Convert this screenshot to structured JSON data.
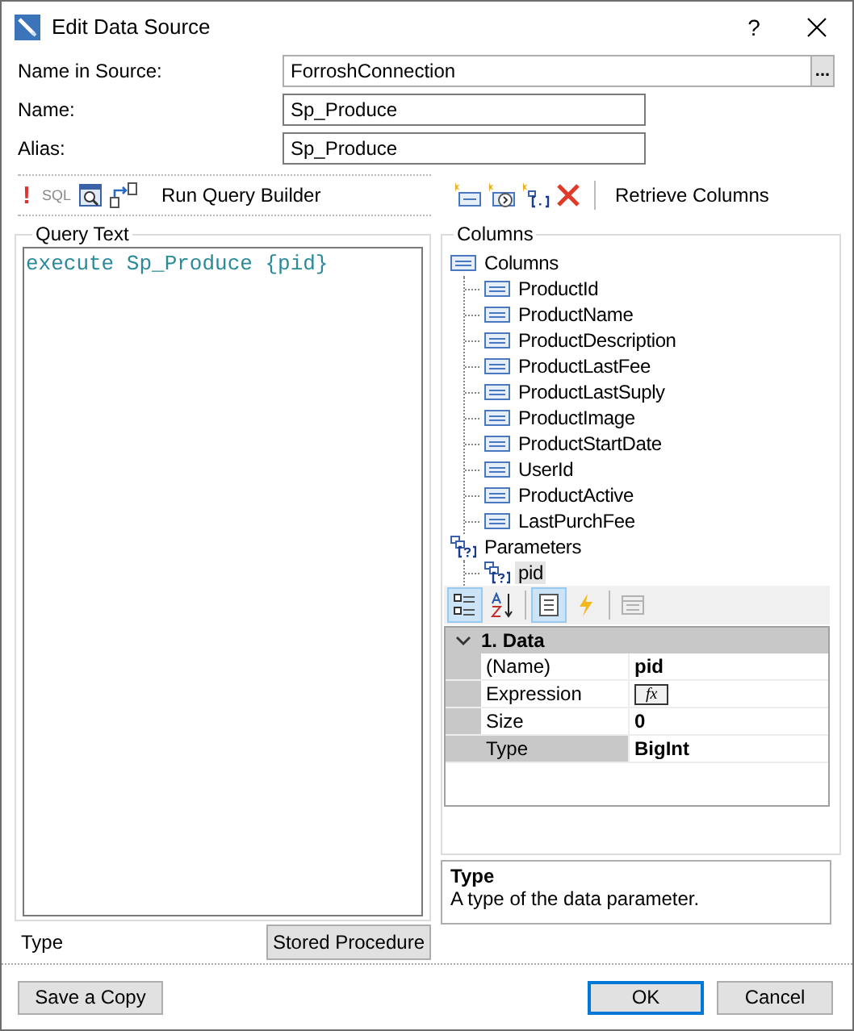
{
  "window": {
    "title": "Edit Data Source",
    "help": "?"
  },
  "fields": [
    {
      "label": "Name in Source:",
      "value": "ForroshConnection",
      "kind": "browse",
      "button": "..."
    },
    {
      "label": "Name:",
      "value": "Sp_Produce",
      "kind": "text"
    },
    {
      "label": "Alias:",
      "value": "Sp_Produce",
      "kind": "text"
    }
  ],
  "query_toolbar": {
    "run_mark": "!",
    "sql": "SQL",
    "builder": "Run Query Builder"
  },
  "columns_toolbar": {
    "retrieve": "Retrieve Columns"
  },
  "query_text": {
    "title": "Query Text",
    "code": "execute Sp_Produce {pid}",
    "type_label": "Type",
    "type_value": "Stored Procedure"
  },
  "columns": {
    "title": "Columns",
    "tree": [
      {
        "label": "Columns",
        "kind": "columns",
        "selected": false,
        "children": [
          {
            "label": "ProductId",
            "kind": "column",
            "selected": false
          },
          {
            "label": "ProductName",
            "kind": "column",
            "selected": false
          },
          {
            "label": "ProductDescription",
            "kind": "column",
            "selected": false
          },
          {
            "label": "ProductLastFee",
            "kind": "column",
            "selected": false
          },
          {
            "label": "ProductLastSuply",
            "kind": "column",
            "selected": false
          },
          {
            "label": "ProductImage",
            "kind": "column",
            "selected": false
          },
          {
            "label": "ProductStartDate",
            "kind": "column",
            "selected": false
          },
          {
            "label": "UserId",
            "kind": "column",
            "selected": false
          },
          {
            "label": "ProductActive",
            "kind": "column",
            "selected": false
          },
          {
            "label": "LastPurchFee",
            "kind": "column",
            "selected": false
          }
        ]
      },
      {
        "label": "Parameters",
        "kind": "parameters",
        "selected": false,
        "children": [
          {
            "label": "pid",
            "kind": "parameter",
            "selected": true
          }
        ]
      }
    ]
  },
  "property_grid": {
    "toolbar": [
      {
        "kind": "categorized",
        "selected": true,
        "disabled": false
      },
      {
        "kind": "alphabetical",
        "selected": false,
        "disabled": false
      },
      {
        "kind": "properties",
        "selected": true,
        "disabled": false
      },
      {
        "kind": "events",
        "selected": false,
        "disabled": false
      },
      {
        "kind": "pages",
        "selected": false,
        "disabled": true
      }
    ],
    "categories": [
      {
        "label": "1. Data",
        "expanded": true,
        "properties": [
          {
            "name": "(Name)",
            "value": "pid",
            "kind": "text",
            "selected": false
          },
          {
            "name": "Expression",
            "value": "fx",
            "kind": "expression",
            "selected": false
          },
          {
            "name": "Size",
            "value": "0",
            "kind": "text",
            "selected": false
          },
          {
            "name": "Type",
            "value": "BigInt",
            "kind": "text",
            "selected": true
          }
        ]
      }
    ],
    "description": {
      "title": "Type",
      "text": "A type of the data parameter."
    }
  },
  "footer": [
    {
      "label": "Save a Copy",
      "default": false
    },
    {
      "label": "OK",
      "default": true
    },
    {
      "label": "Cancel",
      "default": false
    }
  ]
}
